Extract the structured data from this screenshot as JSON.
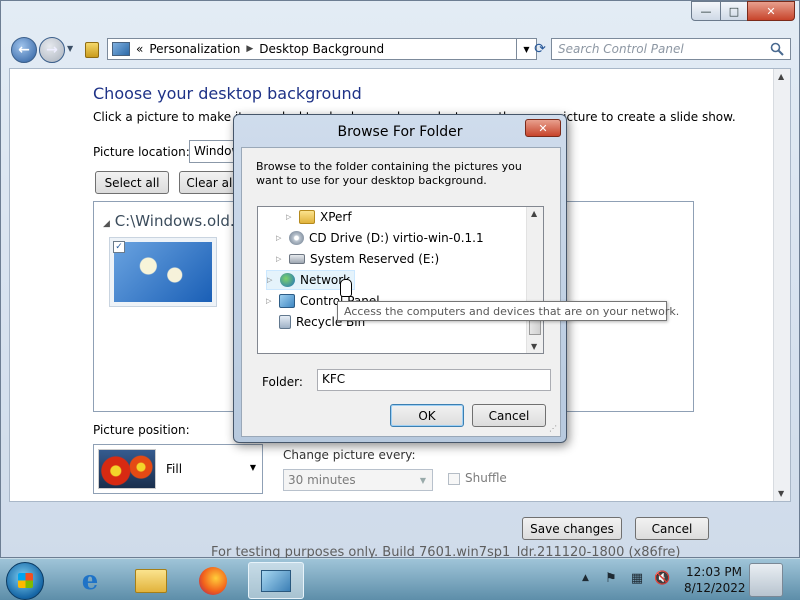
{
  "window": {
    "minimize_icon": "minimize-icon",
    "maximize_icon": "maximize-icon",
    "close_icon": "close-icon",
    "minimize_glyph": "—",
    "maximize_glyph": "□",
    "close_glyph": "✕"
  },
  "nav": {
    "back_glyph": "←",
    "forward_glyph": "→",
    "recent_glyph": "▼",
    "breadcrumb": [
      "Personalization",
      "Desktop Background"
    ],
    "breadcrumb_prefix": "«",
    "separator": "▶",
    "dropdown_glyph": "▼",
    "refresh_glyph": "⟳",
    "search_placeholder": "Search Control Panel"
  },
  "main": {
    "title": "Choose your desktop background",
    "description": "Click a picture to make it your desktop background, or select more than one picture to create a slide show.",
    "picture_location_label": "Picture location:",
    "picture_location_value": "Windows",
    "select_all_label": "Select all",
    "clear_all_label": "Clear all",
    "folder_group": "C:\\Windows.old.000",
    "group_expander": "◢",
    "thumb_checked": "✓",
    "picture_position_label": "Picture position:",
    "picture_position_value": "Fill",
    "change_picture_label": "Change picture every:",
    "interval_value": "30 minutes",
    "shuffle_label": "Shuffle",
    "save_label": "Save changes",
    "cancel_label": "Cancel"
  },
  "dialog": {
    "title": "Browse For Folder",
    "description": "Browse to the folder containing the pictures you want to use for your desktop background.",
    "tree": [
      {
        "label": "XPerf",
        "icon": "folder-icon"
      },
      {
        "label": "CD Drive (D:) virtio-win-0.1.1",
        "icon": "cd-drive-icon"
      },
      {
        "label": "System Reserved (E:)",
        "icon": "drive-icon"
      },
      {
        "label": "Network",
        "icon": "network-icon"
      },
      {
        "label": "Control Panel",
        "icon": "control-panel-icon"
      },
      {
        "label": "Recycle Bin",
        "icon": "recycle-bin-icon"
      }
    ],
    "expander_glyph": "▷",
    "tooltip": "Access the computers and devices that are on your network.",
    "folder_label": "Folder:",
    "folder_value": "KFC",
    "ok_label": "OK",
    "cancel_label": "Cancel",
    "close_glyph": "✕"
  },
  "watermark": "For testing purposes only. Build 7601.win7sp1_ldr.211120-1800 (x86fre)",
  "taskbar": {
    "clock_time": "12:03 PM",
    "clock_date": "8/12/2022",
    "tray_arrow": "▲",
    "flag_glyph": "⚑",
    "network_glyph": "▦",
    "volume_glyph": "🔇"
  }
}
